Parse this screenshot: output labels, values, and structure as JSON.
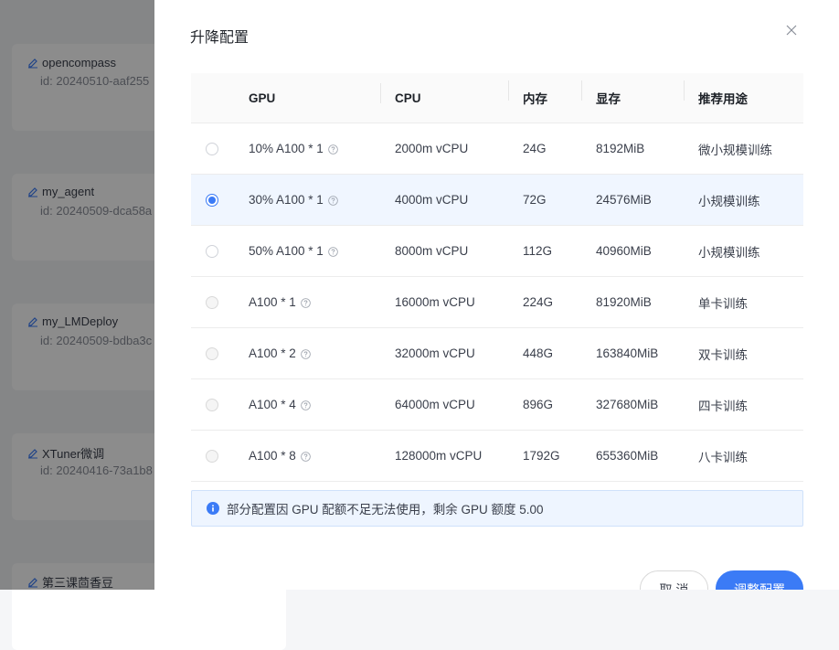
{
  "background": {
    "cards": [
      {
        "title": "opencompass",
        "sub": "id: 20240510-aaf255"
      },
      {
        "title": "my_agent",
        "sub": "id: 20240509-dca58a"
      },
      {
        "title": "my_LMDeploy",
        "sub": "id: 20240509-bdba3c"
      },
      {
        "title": "XTuner微调",
        "sub": "id: 20240416-73a1b8"
      },
      {
        "title": "第三课茴香豆",
        "sub": ""
      }
    ]
  },
  "drawer": {
    "title": "升降配置",
    "columns": [
      "GPU",
      "CPU",
      "内存",
      "显存",
      "推荐用途"
    ],
    "rows": [
      {
        "gpu": "10% A100 * 1",
        "cpu": "2000m vCPU",
        "mem": "24G",
        "vram": "8192MiB",
        "use": "微小规模训练",
        "state": "available"
      },
      {
        "gpu": "30% A100 * 1",
        "cpu": "4000m vCPU",
        "mem": "72G",
        "vram": "24576MiB",
        "use": "小规模训练",
        "state": "selected"
      },
      {
        "gpu": "50% A100 * 1",
        "cpu": "8000m vCPU",
        "mem": "112G",
        "vram": "40960MiB",
        "use": "小规模训练",
        "state": "available"
      },
      {
        "gpu": "A100 * 1",
        "cpu": "16000m vCPU",
        "mem": "224G",
        "vram": "81920MiB",
        "use": "单卡训练",
        "state": "disabled"
      },
      {
        "gpu": "A100 * 2",
        "cpu": "32000m vCPU",
        "mem": "448G",
        "vram": "163840MiB",
        "use": "双卡训练",
        "state": "disabled"
      },
      {
        "gpu": "A100 * 4",
        "cpu": "64000m vCPU",
        "mem": "896G",
        "vram": "327680MiB",
        "use": "四卡训练",
        "state": "disabled"
      },
      {
        "gpu": "A100 * 8",
        "cpu": "128000m vCPU",
        "mem": "1792G",
        "vram": "655360MiB",
        "use": "八卡训练",
        "state": "disabled"
      }
    ],
    "notice": "部分配置因 GPU 配额不足无法使用，剩余 GPU 额度 5.00",
    "cancel_label": "取 消",
    "confirm_label": "调整配置"
  },
  "colors": {
    "accent": "#3b7bf6",
    "selected_row": "#f0f6ff",
    "notice_bg": "#eef5ff"
  },
  "icons": {
    "close": "close-icon",
    "help": "question-circle-icon",
    "info": "info-circle-icon",
    "edit": "edit-icon"
  }
}
